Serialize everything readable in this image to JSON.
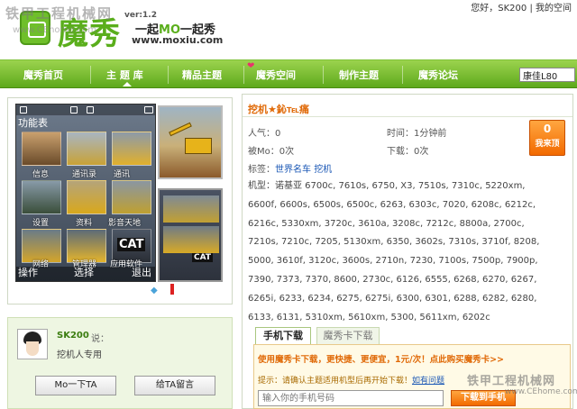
{
  "header": {
    "logo_text": "魔秀",
    "version": "ver:1.2",
    "slogan_pre": "一起",
    "slogan_mo": "MO",
    "slogan_post": "一起秀",
    "url": "www.moxiu.com",
    "user_greeting": "您好，SK200 | 我的空间",
    "watermark": "铁甲工程机械网",
    "watermark_url": "www.CEhome.com"
  },
  "nav": {
    "items": [
      "魔秀首页",
      "主 题 库",
      "精品主题",
      "魔秀空间",
      "制作主题",
      "魔秀论坛"
    ],
    "active_index": 1,
    "search_value": "康佳L80"
  },
  "preview": {
    "phone_title": "功能表",
    "tiles": [
      "信息",
      "通讯录",
      "通讯",
      "设置",
      "资料",
      "影音天地",
      "网络",
      "管理器",
      "应用软件"
    ],
    "soft_left": "操作",
    "soft_mid": "选择",
    "soft_right": "退出",
    "brand_mark": "CAT"
  },
  "author": {
    "name": "SK200",
    "said": "说：",
    "note": "挖机人专用",
    "btn_mo": "Mo一下TA",
    "btn_msg": "给TA留言"
  },
  "detail": {
    "title": "挖机★鈊℡痛",
    "popularity": "人气：0",
    "time": "时间：1分钟前",
    "mo_count": "被Mo：0次",
    "downloads": "下载：0次",
    "tags_label": "标签：",
    "tag1": "世界名车",
    "tag2": "挖机",
    "models_label": "机型：",
    "models": "诺基亚 6700c, 7610s, 6750, X3, 7510s, 7310c, 5220xm, 6600f, 6600s, 6500s, 6500c, 6263, 6303c, 7020, 6208c, 6212c, 6216c, 5330xm, 3720c, 3610a, 3208c, 7212c, 8800a, 2700c, 7210s, 7210c, 7205, 5130xm, 6350, 3602s, 7310s, 3710f, 8208, 5000, 3610f, 3120c, 3600s, 2710n, 7230, 7100s, 7500p, 7900p, 7390, 7373, 7370, 8600, 2730c, 6126, 6555, 6268, 6270, 6267, 6265i, 6233, 6234, 6275, 6275i, 6300, 6301, 6288, 6282, 6280, 6133, 6131, 5310xm, 5610xm, 5300, 5611xm, 6202c",
    "vote_count": "0",
    "vote_label": "我来顶"
  },
  "download": {
    "tab_active": "手机下载",
    "tab_inactive": "魔秀卡下载",
    "promo": "使用魔秀卡下载，更快捷、更便宜，1元/次！点此购买魔秀卡>>",
    "tip_pre": "提示：请确认主题适用机型后再开始下载！",
    "tip_link": "如有问题",
    "phone_placeholder": "输入你的手机号码",
    "btn_label": "下载到手机"
  },
  "watermark_bottom": "铁甲工程机械网",
  "watermark_bottom_url": "www.CEhome.com"
}
